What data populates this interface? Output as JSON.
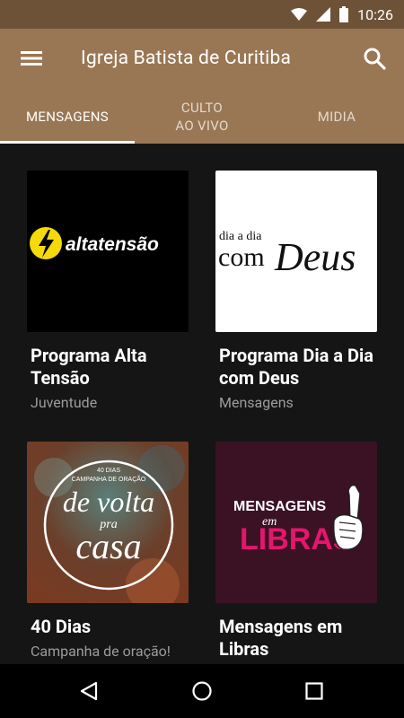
{
  "status": {
    "time": "10:26"
  },
  "app": {
    "title": "Igreja Batista de Curitiba"
  },
  "tabs": [
    {
      "label": "MENSAGENS",
      "line2": ""
    },
    {
      "label": "CULTO",
      "line2": "AO VIVO"
    },
    {
      "label": "MIDIA",
      "line2": ""
    }
  ],
  "cards": [
    {
      "title": "Programa Alta Tensão",
      "subtitle": "Juventude",
      "art_text": "altatensão"
    },
    {
      "title": "Programa Dia a Dia com Deus",
      "subtitle": "Mensagens",
      "art_text_1": "dia a dia",
      "art_text_2": "com",
      "art_text_3": "Deus"
    },
    {
      "title": "40 Dias",
      "subtitle": "Campanha de oração!",
      "art_text_1": "40 DIAS",
      "art_text_2": "CAMPANHA DE ORAÇÃO",
      "art_text_3": "de volta",
      "art_text_4": "pra",
      "art_text_5": "casa"
    },
    {
      "title": "Mensagens em Libras",
      "subtitle": "",
      "art_text_1": "MENSAGENS",
      "art_text_2": "em",
      "art_text_3": "LIBRAS"
    }
  ],
  "colors": {
    "status_bar": "#6e5238",
    "app_bar": "#9a7754",
    "background": "#151515",
    "libras_pink": "#e6156c"
  }
}
